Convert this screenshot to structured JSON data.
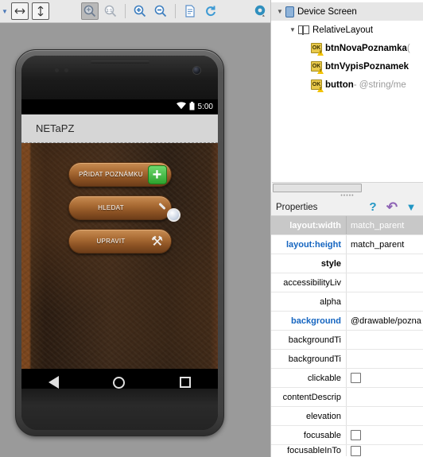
{
  "toolbar": {
    "buttons": [
      {
        "name": "caret-dropdown",
        "glyph": "▼"
      },
      {
        "name": "fit-width-button",
        "glyph": "↔"
      },
      {
        "name": "fit-height-button",
        "glyph": "↕"
      },
      {
        "name": "zoom-to-fit-button",
        "glyph": "⌘"
      },
      {
        "name": "zoom-actual-size-button",
        "glyph": "1:1"
      },
      {
        "name": "zoom-in-button",
        "glyph": "+"
      },
      {
        "name": "zoom-out-button",
        "glyph": "−"
      },
      {
        "name": "file-button",
        "glyph": "≡"
      },
      {
        "name": "refresh-button",
        "glyph": "↻"
      },
      {
        "name": "settings-gear-button",
        "glyph": "⚙"
      }
    ]
  },
  "device": {
    "statusbar": {
      "time": "5:00",
      "wifi_icon": "wifi-icon",
      "battery_icon": "battery-icon"
    },
    "actionbar": {
      "title": "NETaPZ"
    },
    "buttons": [
      {
        "label": "PŘIDAT POZNÁMKU",
        "icon": "plus-icon"
      },
      {
        "label": "HLEDAT",
        "icon": "magnifier-icon"
      },
      {
        "label": "UPRAVIT",
        "icon": "tools-icon"
      }
    ],
    "navbar": [
      {
        "name": "nav-back-button",
        "icon": "triangle-back-icon"
      },
      {
        "name": "nav-home-button",
        "icon": "circle-home-icon"
      },
      {
        "name": "nav-recents-button",
        "icon": "square-recents-icon"
      }
    ]
  },
  "tree": {
    "nodes": [
      {
        "label": "Device Screen",
        "icon": "device-screen-icon",
        "indent": 0,
        "expander": "▼",
        "suffix": "",
        "selected": true
      },
      {
        "label": "RelativeLayout",
        "icon": "relative-layout-icon",
        "indent": 1,
        "expander": "▼",
        "suffix": "",
        "selected": false
      },
      {
        "label": "btnNovaPoznamka",
        "icon": "ok-warning-icon",
        "indent": 2,
        "expander": "",
        "suffix": " (",
        "selected": false
      },
      {
        "label": "btnVypisPoznamek",
        "icon": "ok-warning-icon",
        "indent": 2,
        "expander": "",
        "suffix": "",
        "selected": false
      },
      {
        "label": "button",
        "icon": "ok-warning-icon",
        "indent": 2,
        "expander": "",
        "suffix": " - @string/me",
        "selected": false
      }
    ]
  },
  "properties": {
    "title": "Properties",
    "header_icons": [
      {
        "name": "help-icon",
        "glyph": "?",
        "color": "#2196c4"
      },
      {
        "name": "undo-icon",
        "glyph": "↺",
        "color": "#8e63b5"
      },
      {
        "name": "filter-icon",
        "glyph": "▼",
        "color": "#2196c4"
      }
    ],
    "rows": [
      {
        "name": "layout:width",
        "value": "match_parent",
        "style": "modified",
        "type": "text",
        "selected": true
      },
      {
        "name": "layout:height",
        "value": "match_parent",
        "style": "modified",
        "type": "text",
        "selected": false
      },
      {
        "name": "style",
        "value": "",
        "style": "bold",
        "type": "text",
        "selected": false
      },
      {
        "name": "accessibilityLiv",
        "value": "",
        "style": "plain",
        "type": "text",
        "selected": false
      },
      {
        "name": "alpha",
        "value": "",
        "style": "plain",
        "type": "text",
        "selected": false
      },
      {
        "name": "background",
        "value": "@drawable/pozna",
        "style": "modified",
        "type": "text",
        "selected": false
      },
      {
        "name": "backgroundTi",
        "value": "",
        "style": "plain",
        "type": "text",
        "selected": false
      },
      {
        "name": "backgroundTi",
        "value": "",
        "style": "plain",
        "type": "text",
        "selected": false
      },
      {
        "name": "clickable",
        "value": "",
        "style": "plain",
        "type": "checkbox",
        "selected": false
      },
      {
        "name": "contentDescrip",
        "value": "",
        "style": "plain",
        "type": "text",
        "selected": false
      },
      {
        "name": "elevation",
        "value": "",
        "style": "plain",
        "type": "text",
        "selected": false
      },
      {
        "name": "focusable",
        "value": "",
        "style": "plain",
        "type": "checkbox",
        "selected": false
      },
      {
        "name": "focusableInTo",
        "value": "",
        "style": "plain",
        "type": "checkbox",
        "selected": false
      }
    ]
  }
}
